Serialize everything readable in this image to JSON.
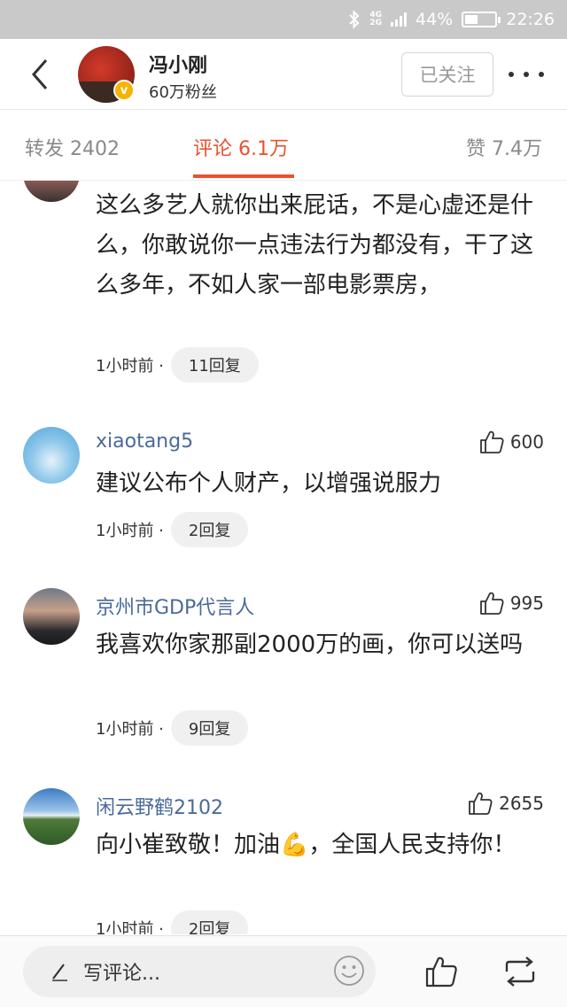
{
  "status_bar": {
    "network_top": "4G",
    "network_bottom": "2G",
    "battery": "44%",
    "battery_level": 0.44,
    "time": "22:26"
  },
  "header": {
    "title": "冯小刚",
    "followers": "60万粉丝",
    "follow_button": "已关注"
  },
  "tabs": [
    {
      "label": "转发 2402",
      "active": false
    },
    {
      "label": "评论 6.1万",
      "active": true
    },
    {
      "label": "赞 7.4万",
      "active": false
    }
  ],
  "comments": [
    {
      "user": "",
      "likes": "",
      "text": "这么多艺人就你出来屁话，不是心虚还是什么，你敢说你一点违法行为都没有，干了这么多年，不如人家一部电影票房，",
      "time": "1小时前 ·",
      "replies": "11回复"
    },
    {
      "user": "xiaotang5",
      "likes": "600",
      "text": "建议公布个人财产，以增强说服力",
      "time": "1小时前 ·",
      "replies": "2回复"
    },
    {
      "user": "京州市GDP代言人",
      "likes": "995",
      "text": "我喜欢你家那副2000万的画，你可以送吗",
      "time": "1小时前 ·",
      "replies": "9回复"
    },
    {
      "user": "闲云野鹤2102",
      "likes": "2655",
      "text": "向小崔致敬！加油💪，全国人民支持你！",
      "time": "1小时前 ·",
      "replies": "2回复"
    }
  ],
  "bottom_bar": {
    "compose_placeholder": "写评论..."
  },
  "colors": {
    "accent": "#e8522f",
    "username": "#4a6a9a",
    "status_bar": "#c9c9c9"
  }
}
